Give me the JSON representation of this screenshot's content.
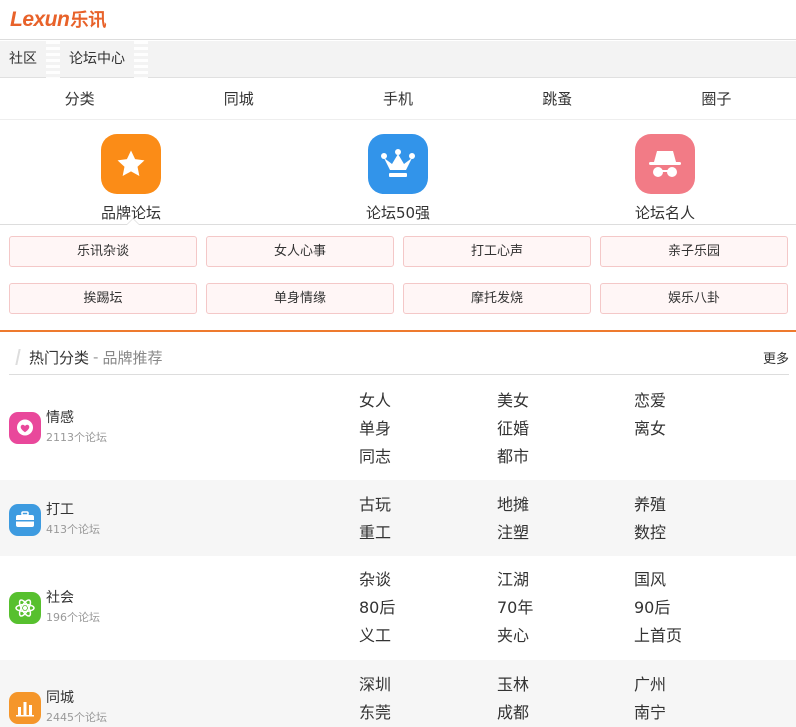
{
  "logo": {
    "latin": "Lexun",
    "cn": "乐讯"
  },
  "breadcrumb": [
    "社区",
    "论坛中心"
  ],
  "nav": [
    "分类",
    "同城",
    "手机",
    "跳蚤",
    "圈子"
  ],
  "featured": [
    {
      "label": "品牌论坛",
      "icon": "star-icon",
      "color": "#fb8c17"
    },
    {
      "label": "论坛50强",
      "icon": "crown-icon",
      "color": "#3294ea"
    },
    {
      "label": "论坛名人",
      "icon": "incognito-icon",
      "color": "#f27b86"
    }
  ],
  "tags": [
    "乐讯杂谈",
    "女人心事",
    "打工心声",
    "亲子乐园",
    "挨踢坛",
    "单身情缘",
    "摩托发烧",
    "娱乐八卦"
  ],
  "section": {
    "title": "热门分类",
    "sep": "-",
    "subtitle": "品牌推荐",
    "more": "更多"
  },
  "categories": [
    {
      "name": "情感",
      "count": "2113个论坛",
      "icon": "heart-chat-icon",
      "color": "#e9489b",
      "links": [
        "女人",
        "美女",
        "恋爱",
        "单身",
        "征婚",
        "离女",
        "同志",
        "都市"
      ]
    },
    {
      "name": "打工",
      "count": "413个论坛",
      "icon": "briefcase-icon",
      "color": "#3d9be0",
      "links": [
        "古玩",
        "地摊",
        "养殖",
        "重工",
        "注塑",
        "数控"
      ]
    },
    {
      "name": "社会",
      "count": "196个论坛",
      "icon": "atom-icon",
      "color": "#57c02e",
      "links": [
        "杂谈",
        "江湖",
        "国风",
        "80后",
        "70年",
        "90后",
        "义工",
        "夹心",
        "上首页"
      ]
    },
    {
      "name": "同城",
      "count": "2445个论坛",
      "icon": "bar-chart-icon",
      "color": "#f5962a",
      "links": [
        "深圳",
        "玉林",
        "广州",
        "东莞",
        "成都",
        "南宁"
      ]
    }
  ],
  "colors": {
    "accent": "#ee7a2e",
    "logo": "#e8622a"
  }
}
